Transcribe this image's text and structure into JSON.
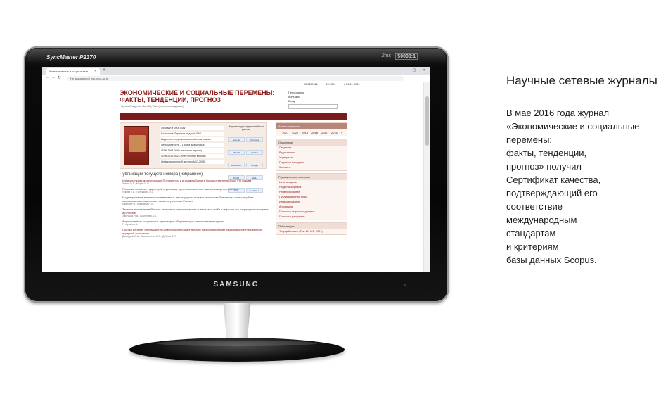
{
  "caption": {
    "title": "Научные сетевые журналы",
    "body": "В мае 2016 года журнал\n«Экономические и социальные\nперемены:\nфакты, тенденции,\nпрогноз» получил\nСертификат качества,\nподтверждающий его\nсоответствие\nмеждународным\nстандартам\n и критериям\nбазы данных Scopus."
  },
  "monitor": {
    "model": "SyncMaster P2370",
    "spec": "50000:1",
    "response": "2ms",
    "brand": "SAMSUNG"
  },
  "browser": {
    "tab_title": "Экономические и социальные...",
    "url": "Не защищено | esc.vscc.ac.ru"
  },
  "site": {
    "dates": [
      "22.02.2021",
      "13.2021",
      "c 01.01.2021"
    ],
    "title_line1": "Экономические и социальные перемены:",
    "title_line2": "факты, тенденции, прогноз",
    "subtitle": "Научный журнал ВолНЦ РАН (печатное издание)",
    "header_links": [
      "Персоналии",
      "Контакты",
      "Вход"
    ],
    "menu": [
      "ВолНЦ РАН",
      "О журнале",
      "Редакционная политика",
      "Публикации",
      "Авторам",
      "Рецензентам",
      "Сайты ВолНЦ РАН"
    ],
    "facts": [
      "Основан в 2008 году",
      "Включен в Перечень изданий ВАК",
      "Издается на русском и английском языках",
      "Периодичность – 1 раз в два месяца",
      "ISSN 1998-0698 (печатная версия)",
      "ISSN 2312-9824 (электронная версия)",
      "Информационный партнер MIC-2018"
    ],
    "indexed_label": "Журнал индексируется в базах данных",
    "logos": [
      "Scopus",
      "ProQuest",
      "EBSCO",
      "RePEc",
      "eLIBRARY",
      "Google",
      "DOAJ",
      "ERIH",
      "MIC",
      "ULRICH"
    ],
    "pubs_heading": "Публикации текущего номера (избранное)",
    "publications": [
      {
        "title": "Избирательная модернизация Президента: к итогам выборов в Государственную Думу VIII созыва",
        "authors": "Ильин В.А., Морев М.В."
      },
      {
        "title": "Развитие сельских территорий в условиях пространственного сжатия северного региона",
        "authors": "Ускова Т.В., Патракова С.С."
      },
      {
        "title": "Моделирование влияния привлекаемых институциональными секторами банковских инвестиций на социально-экономическое развитие регионов России",
        "authors": "Иванов Р.В., Ковалева Н.Л."
      },
      {
        "title": "Теневая экономика в России: экономико-статистическая оценка масштаба и меры по его сокращению в стране и регионах",
        "authors": "Зарецкая Н.В., Шабунова А.А."
      },
      {
        "title": "Формирование социальных ориентиров сберегающего развития металлургии",
        "authors": "Гутарова А.А."
      },
      {
        "title": "Оценка влияния инновационно-инвестиционной активности на формирование экспорта ориентированной аграрной экономики",
        "authors": "Давыдова Е.А., Васильченко М.Я., Дубова В.Л."
      }
    ],
    "sidebar": {
      "archive_head": "Архив выпусков",
      "years": [
        "‹",
        "2021",
        "2020",
        "2019",
        "2018",
        "2017",
        "2016",
        "›"
      ],
      "about_head": "О журнале",
      "about_items": [
        "Сведения",
        "Редколлегия",
        "Учредитель",
        "Подписка на журнал",
        "Контакты"
      ],
      "policy_head": "Редакционная политика",
      "policy_items": [
        "Цели и задачи",
        "Разделы журнала",
        "Рецензирование",
        "Публикационная этика",
        "Индексирование",
        "Архивация",
        "Политика открытого доступа",
        "Политика раскрытия"
      ],
      "pubs_head": "Публикации",
      "pubs_items": [
        "Текущий номер (Том 14, №5, 2021)"
      ]
    }
  }
}
